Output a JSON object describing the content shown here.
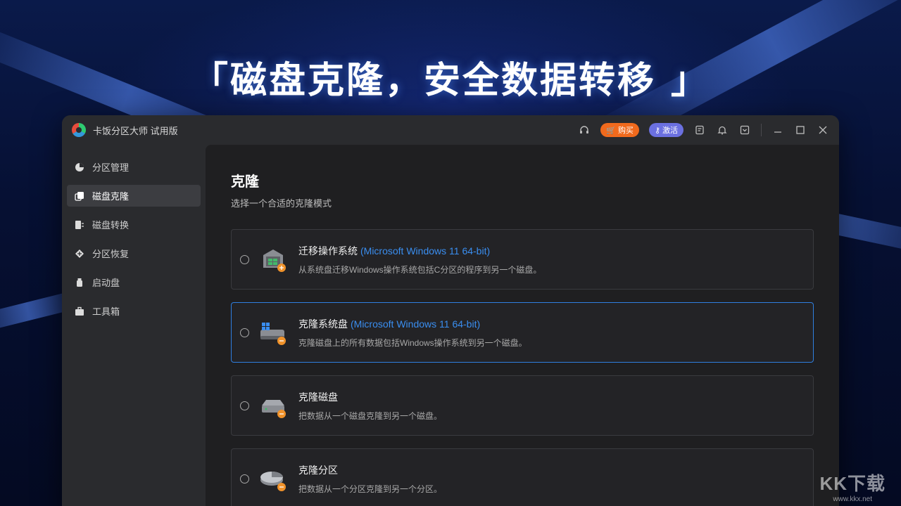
{
  "banner": {
    "text": "「磁盘克隆，安全数据转移 」"
  },
  "window": {
    "title": "卡饭分区大师 试用版",
    "buy_label": "购买",
    "activate_label": "激活"
  },
  "sidebar": {
    "items": [
      {
        "label": "分区管理",
        "icon": "pie-chart-icon"
      },
      {
        "label": "磁盘克隆",
        "icon": "disk-clone-icon"
      },
      {
        "label": "磁盘转换",
        "icon": "disk-convert-icon"
      },
      {
        "label": "分区恢复",
        "icon": "recover-icon"
      },
      {
        "label": "启动盘",
        "icon": "usb-drive-icon"
      },
      {
        "label": "工具箱",
        "icon": "toolbox-icon"
      }
    ]
  },
  "main": {
    "title": "克隆",
    "subtitle": "选择一个合适的克隆模式",
    "options": [
      {
        "title": "迁移操作系统",
        "os": "(Microsoft Windows 11 64-bit)",
        "desc": "从系统盘迁移Windows操作系统包括C分区的程序到另一个磁盘。"
      },
      {
        "title": "克隆系统盘",
        "os": "(Microsoft Windows 11 64-bit)",
        "desc": "克隆磁盘上的所有数据包括Windows操作系统到另一个磁盘。"
      },
      {
        "title": "克隆磁盘",
        "os": "",
        "desc": "把数据从一个磁盘克隆到另一个磁盘。"
      },
      {
        "title": "克隆分区",
        "os": "",
        "desc": "把数据从一个分区克隆到另一个分区。"
      }
    ]
  },
  "watermark": {
    "brand": "KK下载",
    "url": "www.kkx.net"
  },
  "colors": {
    "accent": "#2f7fe0",
    "buy": "#f06a1d",
    "activate": "#6b70e0"
  }
}
